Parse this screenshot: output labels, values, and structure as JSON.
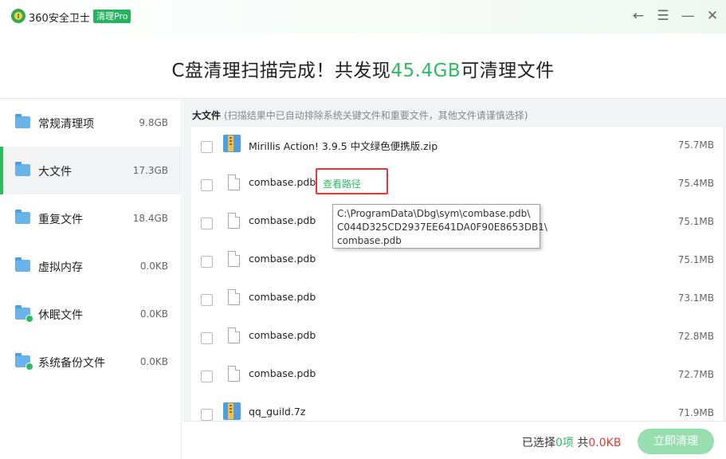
{
  "app": {
    "title": "360安全卫士",
    "badge": "清理Pro",
    "controls": [
      "←",
      "☰",
      "—",
      "✕"
    ]
  },
  "banner": {
    "prefix": "C盘清理扫描完成！共发现",
    "amount": "45.4GB",
    "suffix": "可清理文件"
  },
  "sidebar": {
    "items": [
      {
        "label": "常规清理项",
        "size": "9.8GB",
        "icon": "folder-icon"
      },
      {
        "label": "大文件",
        "size": "17.3GB",
        "icon": "folder-icon",
        "active": true
      },
      {
        "label": "重复文件",
        "size": "18.4GB",
        "icon": "folder-icon"
      },
      {
        "label": "虚拟内存",
        "size": "0.0KB",
        "icon": "folder-icon"
      },
      {
        "label": "休眠文件",
        "size": "0.0KB",
        "icon": "folder-sleep-icon"
      },
      {
        "label": "系统备份文件",
        "size": "0.0KB",
        "icon": "folder-backup-icon"
      }
    ]
  },
  "section": {
    "name": "大文件",
    "note": "(扫描结果中已自动排除系统关键文件和重要文件，其他文件请谨慎选择)"
  },
  "files": [
    {
      "name": "Mirillis Action! 3.9.5 中文绿色便携版.zip",
      "size": "75.7MB",
      "icon": "zip-icon"
    },
    {
      "name": "combase.pdb",
      "size": "75.4MB",
      "icon": "file-icon",
      "link": "查看路径"
    },
    {
      "name": "combase.pdb",
      "size": "75.1MB",
      "icon": "file-icon"
    },
    {
      "name": "combase.pdb",
      "size": "75.1MB",
      "icon": "file-icon"
    },
    {
      "name": "combase.pdb",
      "size": "73.1MB",
      "icon": "file-icon"
    },
    {
      "name": "combase.pdb",
      "size": "72.8MB",
      "icon": "file-icon"
    },
    {
      "name": "combase.pdb",
      "size": "72.7MB",
      "icon": "file-icon"
    },
    {
      "name": "qq_guild.7z",
      "size": "71.9MB",
      "icon": "zip-icon"
    }
  ],
  "tooltip": {
    "lines": [
      "C:\\ProgramData\\Dbg\\sym\\combase.pdb\\",
      "C044D325CD2937EE641DA0F90E8653DB1\\",
      "combase.pdb"
    ]
  },
  "footer": {
    "selected_prefix": "已选择",
    "selected_count": "0项",
    "total_prefix": " 共",
    "total_size": "0.0KB",
    "clean_button": "立即清理"
  },
  "colors": {
    "accent": "#2dbd60",
    "highlight": "#e53935",
    "button_disabled": "#98dfb0"
  }
}
